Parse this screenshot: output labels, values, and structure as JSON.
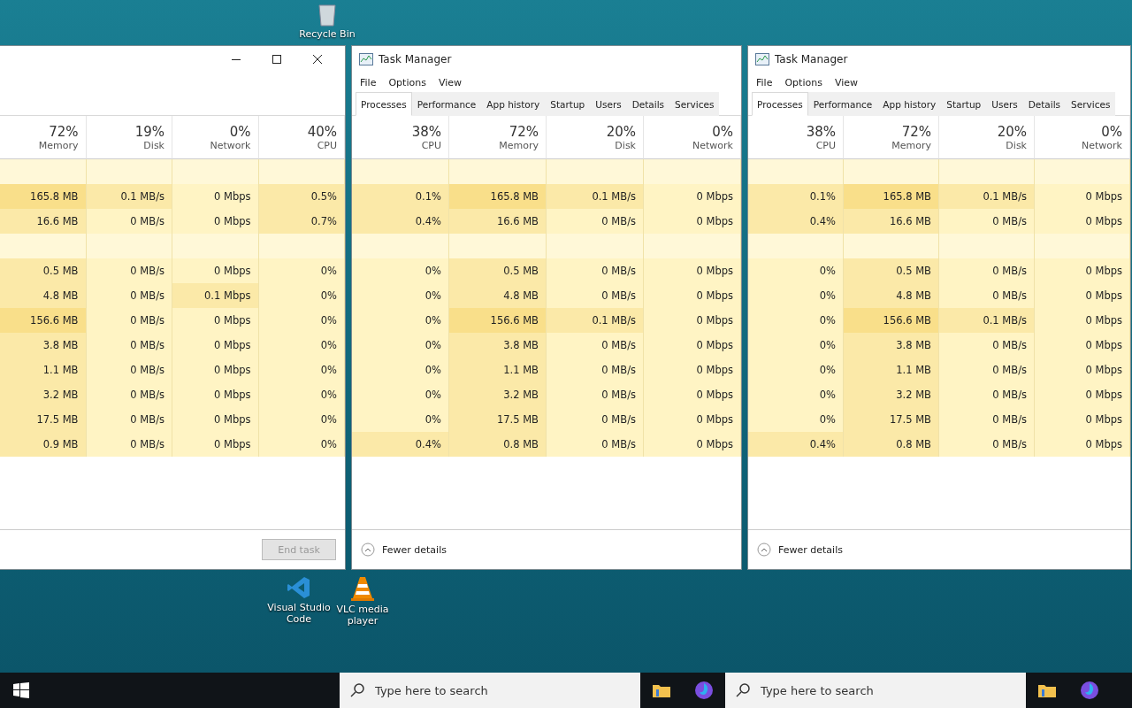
{
  "desktop_icons": [
    {
      "label": "Recycle Bin",
      "kind": "bin"
    },
    {
      "label": "Visual Studio Code",
      "kind": "code"
    },
    {
      "label": "VLC media player",
      "kind": "cone"
    }
  ],
  "left_window": {
    "columns": [
      {
        "percent": "72%",
        "label": "Memory"
      },
      {
        "percent": "19%",
        "label": "Disk"
      },
      {
        "percent": "0%",
        "label": "Network"
      },
      {
        "percent": "40%",
        "label": "CPU"
      }
    ],
    "rows": [
      {
        "kind": "blank"
      },
      {
        "kind": "process",
        "cells": [
          "165.8 MB",
          "0.1 MB/s",
          "0 Mbps",
          "0.5%"
        ]
      },
      {
        "kind": "process",
        "cells": [
          "16.6 MB",
          "0 MB/s",
          "0 Mbps",
          "0.7%"
        ]
      },
      {
        "kind": "blank"
      },
      {
        "kind": "process",
        "cells": [
          "0.5 MB",
          "0 MB/s",
          "0 Mbps",
          "0%"
        ]
      },
      {
        "kind": "process",
        "cells": [
          "4.8 MB",
          "0 MB/s",
          "0.1 Mbps",
          "0%"
        ]
      },
      {
        "kind": "process",
        "cells": [
          "156.6 MB",
          "0 MB/s",
          "0 Mbps",
          "0%"
        ]
      },
      {
        "kind": "process",
        "cells": [
          "3.8 MB",
          "0 MB/s",
          "0 Mbps",
          "0%"
        ]
      },
      {
        "kind": "process",
        "cells": [
          "1.1 MB",
          "0 MB/s",
          "0 Mbps",
          "0%"
        ]
      },
      {
        "kind": "process",
        "cells": [
          "3.2 MB",
          "0 MB/s",
          "0 Mbps",
          "0%"
        ]
      },
      {
        "kind": "process",
        "cells": [
          "17.5 MB",
          "0 MB/s",
          "0 Mbps",
          "0%"
        ]
      },
      {
        "kind": "process",
        "cells": [
          "0.9 MB",
          "0 MB/s",
          "0 Mbps",
          "0%"
        ]
      }
    ],
    "end_task": {
      "label": "End task",
      "disabled": true
    }
  },
  "windows": [
    {
      "title": "Task Manager",
      "menu": [
        "File",
        "Options",
        "View"
      ],
      "tabs": [
        {
          "label": "Processes",
          "selected": true
        },
        {
          "label": "Performance",
          "selected": false
        },
        {
          "label": "App history",
          "selected": false
        },
        {
          "label": "Startup",
          "selected": false
        },
        {
          "label": "Users",
          "selected": false
        },
        {
          "label": "Details",
          "selected": false
        },
        {
          "label": "Services",
          "selected": false
        }
      ],
      "columns": [
        {
          "percent": "38%",
          "label": "CPU"
        },
        {
          "percent": "72%",
          "label": "Memory"
        },
        {
          "percent": "20%",
          "label": "Disk"
        },
        {
          "percent": "0%",
          "label": "Network"
        }
      ],
      "rows": [
        {
          "kind": "blank"
        },
        {
          "kind": "process",
          "cells": [
            "0.1%",
            "165.8 MB",
            "0.1 MB/s",
            "0 Mbps"
          ]
        },
        {
          "kind": "process",
          "cells": [
            "0.4%",
            "16.6 MB",
            "0 MB/s",
            "0 Mbps"
          ]
        },
        {
          "kind": "blank"
        },
        {
          "kind": "process",
          "cells": [
            "0%",
            "0.5 MB",
            "0 MB/s",
            "0 Mbps"
          ]
        },
        {
          "kind": "process",
          "cells": [
            "0%",
            "4.8 MB",
            "0 MB/s",
            "0 Mbps"
          ]
        },
        {
          "kind": "process",
          "cells": [
            "0%",
            "156.6 MB",
            "0.1 MB/s",
            "0 Mbps"
          ]
        },
        {
          "kind": "process",
          "cells": [
            "0%",
            "3.8 MB",
            "0 MB/s",
            "0 Mbps"
          ]
        },
        {
          "kind": "process",
          "cells": [
            "0%",
            "1.1 MB",
            "0 MB/s",
            "0 Mbps"
          ]
        },
        {
          "kind": "process",
          "cells": [
            "0%",
            "3.2 MB",
            "0 MB/s",
            "0 Mbps"
          ]
        },
        {
          "kind": "process",
          "cells": [
            "0%",
            "17.5 MB",
            "0 MB/s",
            "0 Mbps"
          ]
        },
        {
          "kind": "process",
          "cells": [
            "0.4%",
            "0.8 MB",
            "0 MB/s",
            "0 Mbps"
          ]
        }
      ],
      "footer": "Fewer details"
    },
    {
      "title": "Task Manager",
      "menu": [
        "File",
        "Options",
        "View"
      ],
      "tabs": [
        {
          "label": "Processes",
          "selected": true
        },
        {
          "label": "Performance",
          "selected": false
        },
        {
          "label": "App history",
          "selected": false
        },
        {
          "label": "Startup",
          "selected": false
        },
        {
          "label": "Users",
          "selected": false
        },
        {
          "label": "Details",
          "selected": false
        },
        {
          "label": "Services",
          "selected": false
        }
      ],
      "columns": [
        {
          "percent": "38%",
          "label": "CPU"
        },
        {
          "percent": "72%",
          "label": "Memory"
        },
        {
          "percent": "20%",
          "label": "Disk"
        },
        {
          "percent": "0%",
          "label": "Network"
        }
      ],
      "rows": [
        {
          "kind": "blank"
        },
        {
          "kind": "process",
          "cells": [
            "0.1%",
            "165.8 MB",
            "0.1 MB/s",
            "0 Mbps"
          ]
        },
        {
          "kind": "process",
          "cells": [
            "0.4%",
            "16.6 MB",
            "0 MB/s",
            "0 Mbps"
          ]
        },
        {
          "kind": "blank"
        },
        {
          "kind": "process",
          "cells": [
            "0%",
            "0.5 MB",
            "0 MB/s",
            "0 Mbps"
          ]
        },
        {
          "kind": "process",
          "cells": [
            "0%",
            "4.8 MB",
            "0 MB/s",
            "0 Mbps"
          ]
        },
        {
          "kind": "process",
          "cells": [
            "0%",
            "156.6 MB",
            "0.1 MB/s",
            "0 Mbps"
          ]
        },
        {
          "kind": "process",
          "cells": [
            "0%",
            "3.8 MB",
            "0 MB/s",
            "0 Mbps"
          ]
        },
        {
          "kind": "process",
          "cells": [
            "0%",
            "1.1 MB",
            "0 MB/s",
            "0 Mbps"
          ]
        },
        {
          "kind": "process",
          "cells": [
            "0%",
            "3.2 MB",
            "0 MB/s",
            "0 Mbps"
          ]
        },
        {
          "kind": "process",
          "cells": [
            "0%",
            "17.5 MB",
            "0 MB/s",
            "0 Mbps"
          ]
        },
        {
          "kind": "process",
          "cells": [
            "0.4%",
            "0.8 MB",
            "0 MB/s",
            "0 Mbps"
          ]
        }
      ],
      "footer": "Fewer details"
    }
  ],
  "taskbar": {
    "searches": [
      {
        "placeholder": "Type here to search"
      },
      {
        "placeholder": "Type here to search"
      }
    ]
  }
}
